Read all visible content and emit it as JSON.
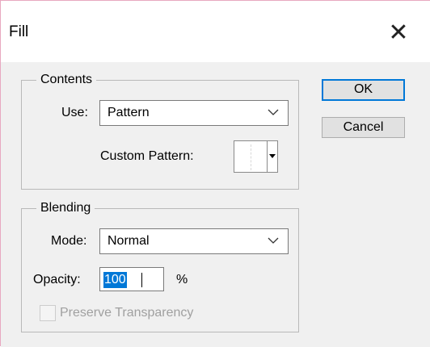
{
  "dialog": {
    "title": "Fill",
    "close_glyph": "✕"
  },
  "contents": {
    "legend": "Contents",
    "use_label": "Use:",
    "use_value": "Pattern",
    "custom_pattern_label": "Custom Pattern:"
  },
  "buttons": {
    "ok": "OK",
    "cancel": "Cancel"
  },
  "blending": {
    "legend": "Blending",
    "mode_label": "Mode:",
    "mode_value": "Normal",
    "opacity_label": "Opacity:",
    "opacity_value": "100",
    "opacity_unit": "%",
    "preserve_label": "Preserve Transparency",
    "preserve_checked": false,
    "preserve_enabled": false
  },
  "colors": {
    "selection": "#0078d7",
    "default_button_border": "#0078d7",
    "window_border": "#e8a8c0"
  },
  "icons": {
    "close": "close-icon",
    "dropdown": "chevron-down-icon",
    "pattern_menu": "triangle-down-icon"
  }
}
